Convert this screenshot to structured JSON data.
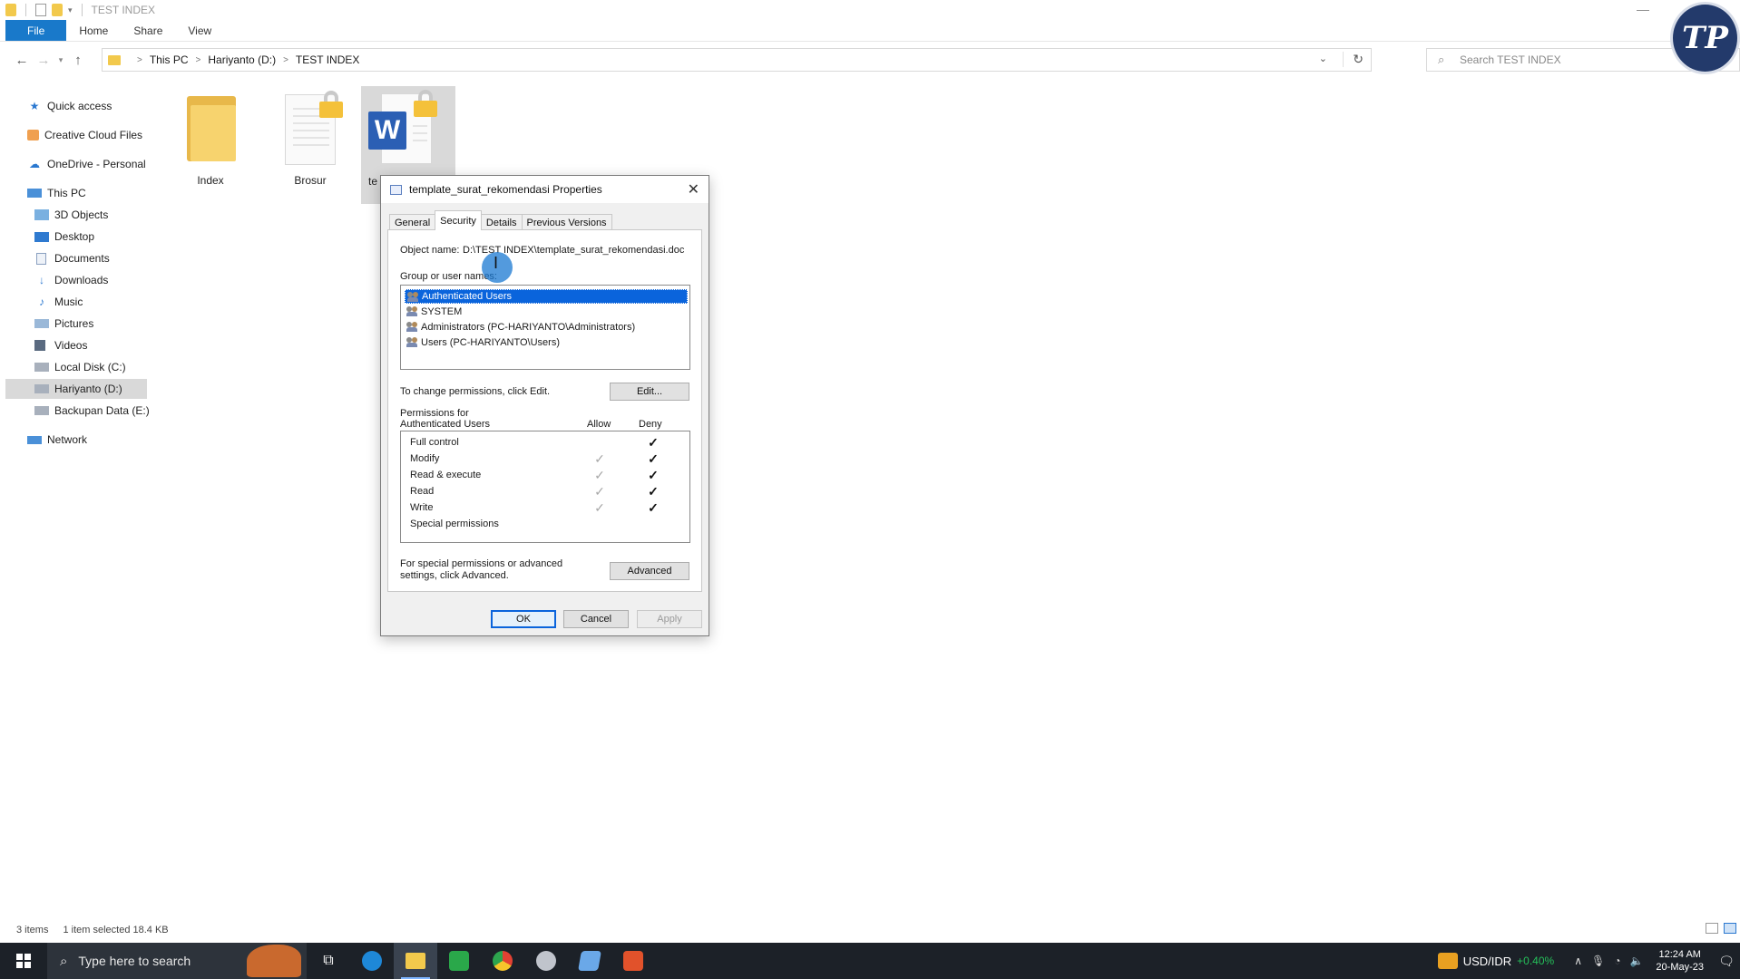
{
  "window": {
    "title": "TEST INDEX",
    "minimize_glyph": "—"
  },
  "ribbon": {
    "tabs": [
      "File",
      "Home",
      "Share",
      "View"
    ]
  },
  "address": {
    "crumbs": [
      "This PC",
      "Hariyanto (D:)",
      "TEST INDEX"
    ],
    "search_placeholder": "Search TEST INDEX"
  },
  "sidebar": {
    "items": [
      {
        "label": "Quick access",
        "icon": "star-icon"
      },
      {
        "label": "Creative Cloud Files",
        "icon": "creative-cloud-icon"
      },
      {
        "label": "OneDrive - Personal",
        "icon": "cloud-icon"
      },
      {
        "label": "This PC",
        "icon": "computer-icon"
      },
      {
        "label": "3D Objects",
        "icon": "cube-icon"
      },
      {
        "label": "Desktop",
        "icon": "desktop-icon"
      },
      {
        "label": "Documents",
        "icon": "document-icon"
      },
      {
        "label": "Downloads",
        "icon": "download-icon"
      },
      {
        "label": "Music",
        "icon": "music-icon"
      },
      {
        "label": "Pictures",
        "icon": "picture-icon"
      },
      {
        "label": "Videos",
        "icon": "video-icon"
      },
      {
        "label": "Local Disk (C:)",
        "icon": "drive-icon"
      },
      {
        "label": "Hariyanto (D:)",
        "icon": "drive-icon",
        "selected": true
      },
      {
        "label": "Backupan Data (E:)",
        "icon": "drive-icon"
      },
      {
        "label": "Network",
        "icon": "network-icon"
      }
    ]
  },
  "files": [
    {
      "label": "Index",
      "type": "folder"
    },
    {
      "label": "Brosur",
      "type": "locked-file"
    },
    {
      "label": "te",
      "type": "word-locked",
      "selected": true
    }
  ],
  "dialog": {
    "title": "template_surat_rekomendasi Properties",
    "tabs": [
      "General",
      "Security",
      "Details",
      "Previous Versions"
    ],
    "active_tab": "Security",
    "object_name_label": "Object name:",
    "object_name_value": "D:\\TEST INDEX\\template_surat_rekomendasi.doc",
    "group_label": "Group or user names:",
    "groups": [
      "Authenticated Users",
      "SYSTEM",
      "Administrators (PC-HARIYANTO\\Administrators)",
      "Users (PC-HARIYANTO\\Users)"
    ],
    "selected_group_index": 0,
    "change_text": "To change permissions, click Edit.",
    "edit_button": "Edit...",
    "permissions_title": "Permissions for Authenticated Users",
    "allow_header": "Allow",
    "deny_header": "Deny",
    "permissions": [
      {
        "name": "Full control",
        "allow": false,
        "deny": true
      },
      {
        "name": "Modify",
        "allow": true,
        "deny": true
      },
      {
        "name": "Read & execute",
        "allow": true,
        "deny": true
      },
      {
        "name": "Read",
        "allow": true,
        "deny": true
      },
      {
        "name": "Write",
        "allow": true,
        "deny": true
      },
      {
        "name": "Special permissions",
        "allow": false,
        "deny": false
      }
    ],
    "advanced_text": "For special permissions or advanced settings, click Advanced.",
    "advanced_button": "Advanced",
    "ok_button": "OK",
    "cancel_button": "Cancel",
    "apply_button": "Apply",
    "check_glyph": "✓"
  },
  "statusbar": {
    "items_count": "3 items",
    "selection": "1 item selected  18.4 KB"
  },
  "logo_text": "TP",
  "taskbar": {
    "search_placeholder": "Type here to search",
    "fx_pair": "USD/IDR",
    "fx_change": "+0.40%",
    "time": "12:24 AM",
    "date": "20-May-23"
  }
}
